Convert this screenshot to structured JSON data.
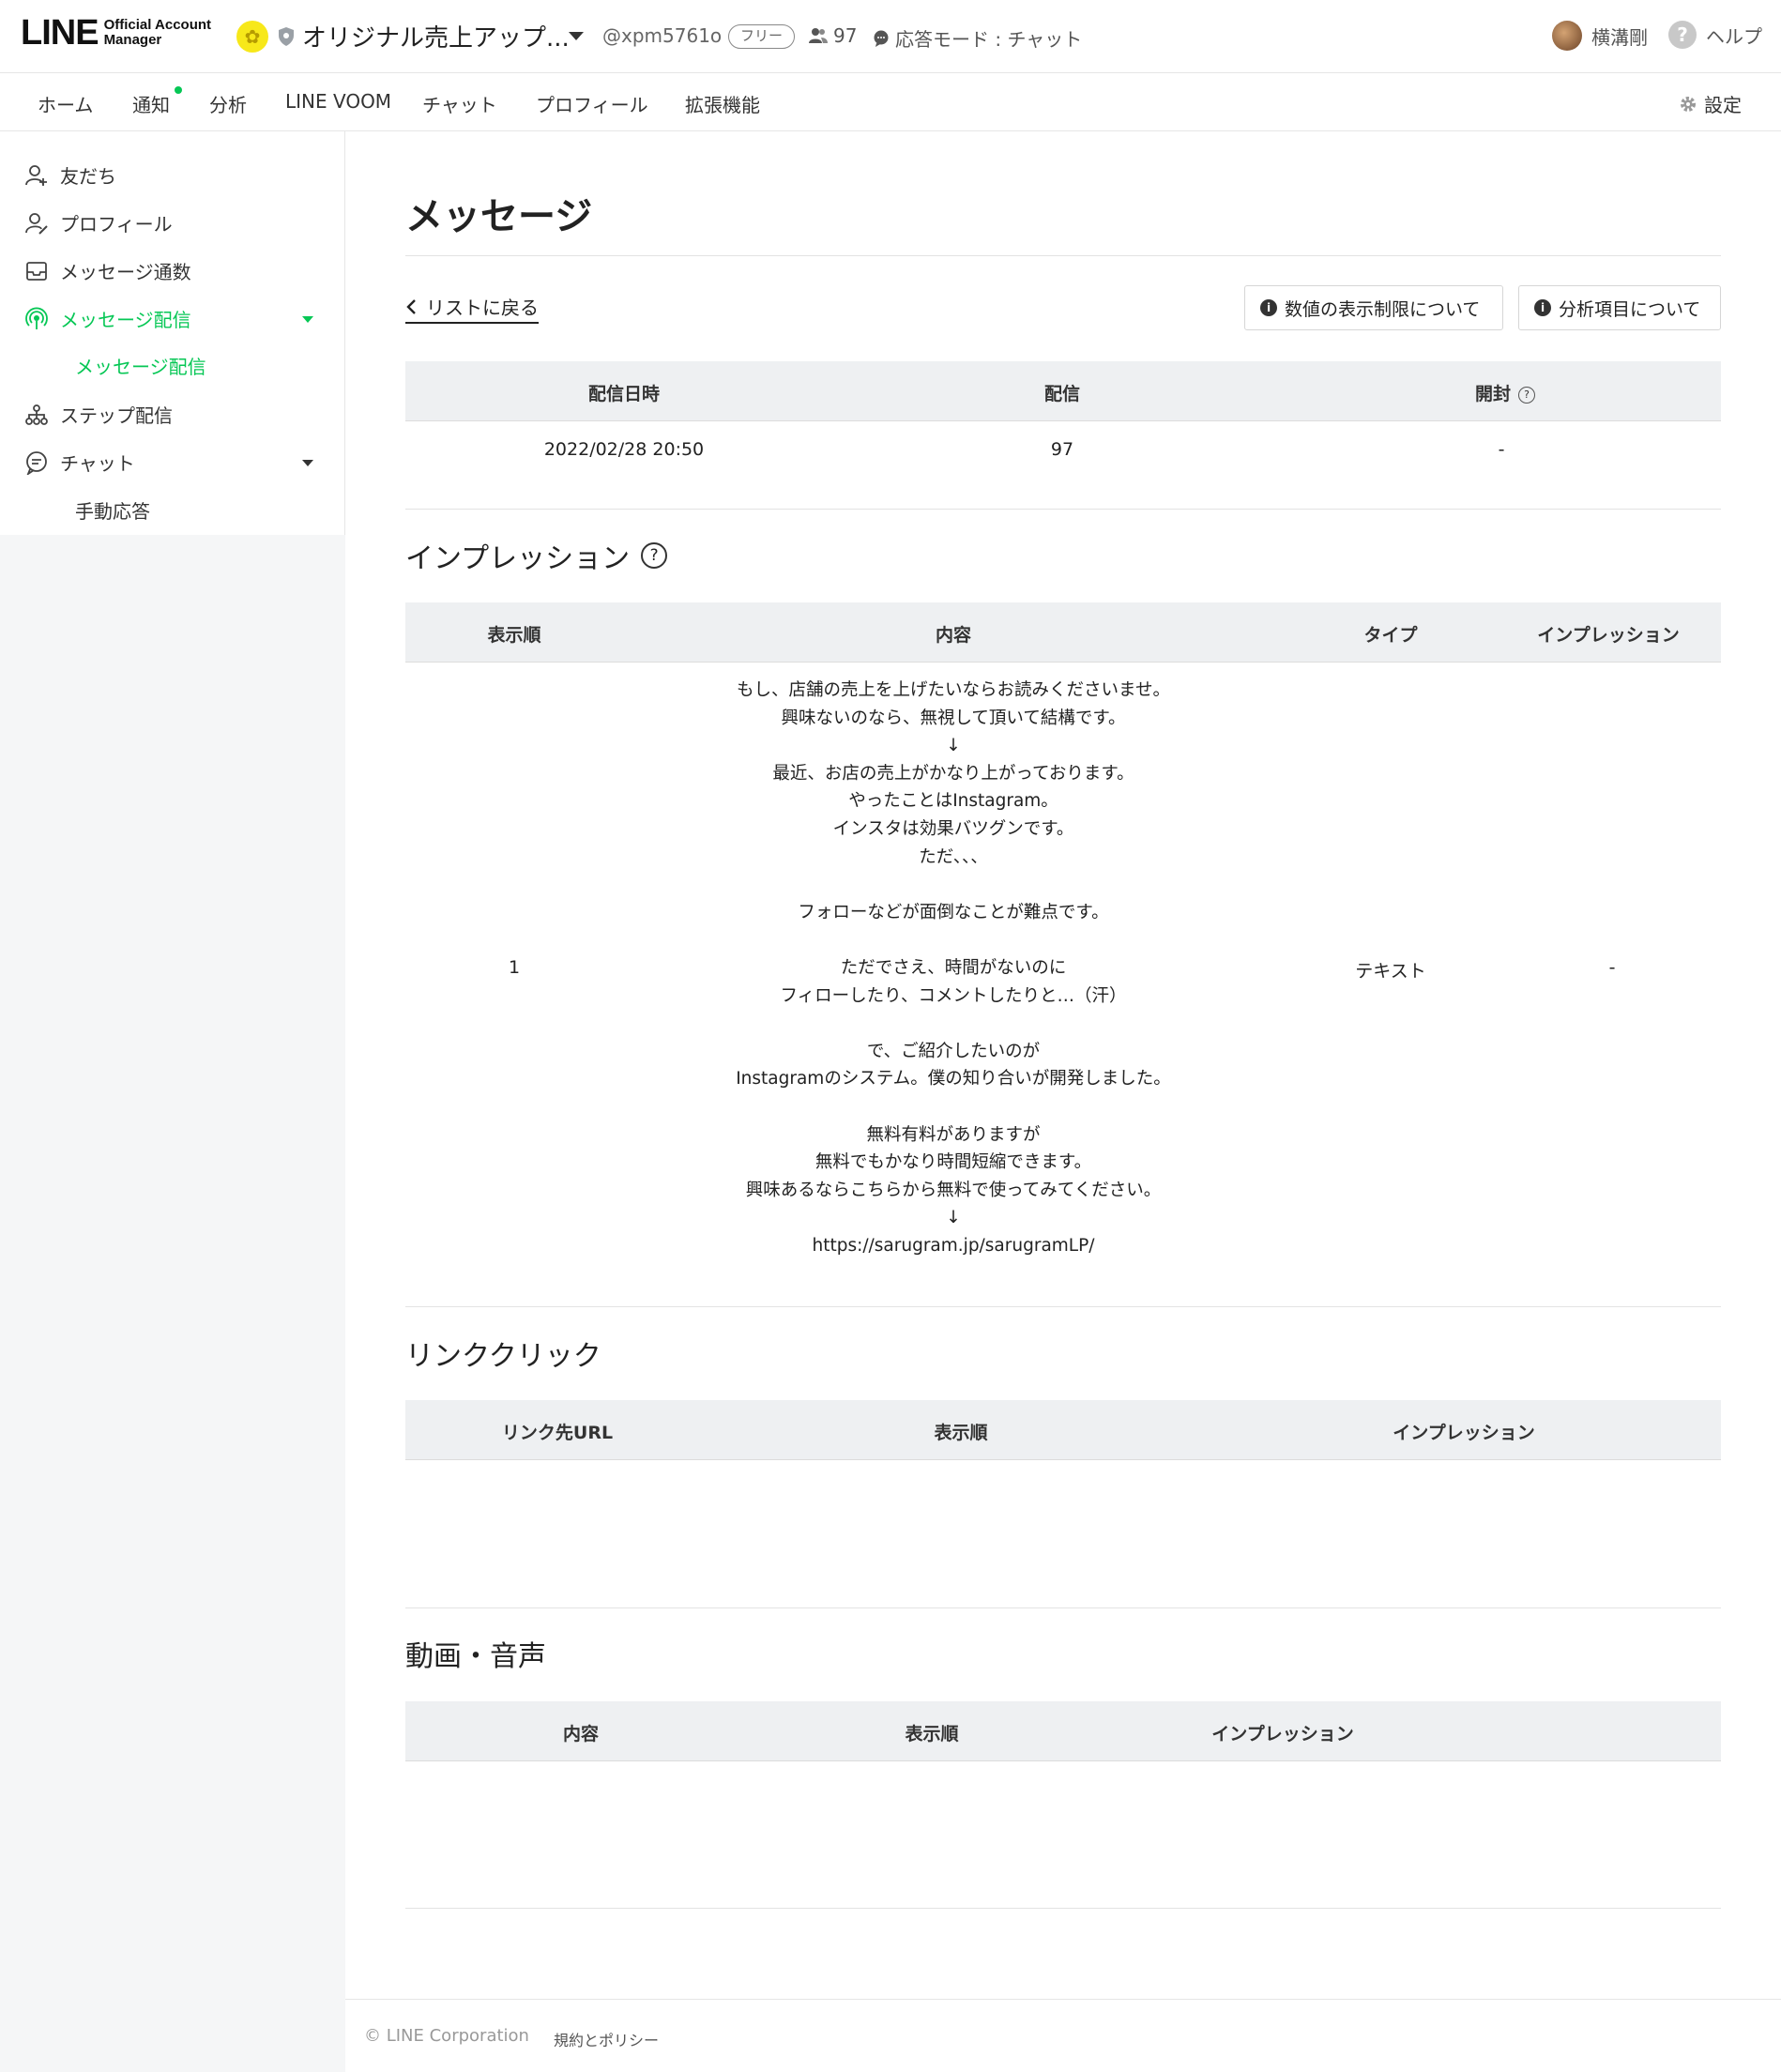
{
  "header": {
    "logo_main": "LINE",
    "logo_sub_1": "Official Account",
    "logo_sub_2": "Manager",
    "account_name": "オリジナル売上アップ...",
    "account_id": "@xpm5761o",
    "plan_badge": "フリー",
    "friend_count": "97",
    "response_mode": "応答モード : チャット",
    "user_name": "横溝剛",
    "help_label": "ヘルプ"
  },
  "nav": {
    "tabs": [
      "ホーム",
      "通知",
      "分析",
      "LINE VOOM",
      "チャット",
      "プロフィール",
      "拡張機能"
    ],
    "active_tab": "分析",
    "settings_label": "設定"
  },
  "sidebar": {
    "items": [
      "友だち",
      "プロフィール",
      "メッセージ通数",
      "メッセージ配信",
      "メッセージ配信",
      "ステップ配信",
      "チャット",
      "手動応答"
    ]
  },
  "main": {
    "page_title": "メッセージ",
    "back_link": "リストに戻る",
    "info_btn_1": "数値の表示制限について",
    "info_btn_2": "分析項目について",
    "summary": {
      "headers": [
        "配信日時",
        "配信",
        "開封"
      ],
      "row": [
        "2022/02/28 20:50",
        "97",
        "-"
      ]
    },
    "impression": {
      "title": "インプレッション",
      "headers": [
        "表示順",
        "内容",
        "タイプ",
        "インプレッション"
      ],
      "row": {
        "order": "1",
        "content": "もし、店舗の売上を上げたいならお読みくださいませ。\n興味ないのなら、無視して頂いて結構です。\n↓\n最近、お店の売上がかなり上がっております。\nやったことはInstagram。\nインスタは効果バツグンです。\nただ、、、\n\nフォローなどが面倒なことが難点です。\n\nただでさえ、時間がないのに\nフィローしたり、コメントしたりと…（汗）\n\nで、ご紹介したいのが\nInstagramのシステム。僕の知り合いが開発しました。\n\n無料有料がありますが\n無料でもかなり時間短縮できます。\n興味あるならこちらから無料で使ってみてください。\n↓\nhttps://sarugram.jp/sarugramLP/",
        "type": "テキスト",
        "impression": "-"
      }
    },
    "link_click": {
      "title": "リンククリック",
      "headers": [
        "リンク先URL",
        "表示順",
        "インプレッション"
      ]
    },
    "video_audio": {
      "title": "動画・音声",
      "headers": [
        "内容",
        "表示順",
        "インプレッション"
      ]
    }
  },
  "footer": {
    "copyright": "© LINE Corporation",
    "policy": "規約とポリシー"
  },
  "colors": {
    "accent": "#06c755",
    "table_header_bg": "#eef0f2",
    "sidebar_bg": "#f5f6f7"
  }
}
